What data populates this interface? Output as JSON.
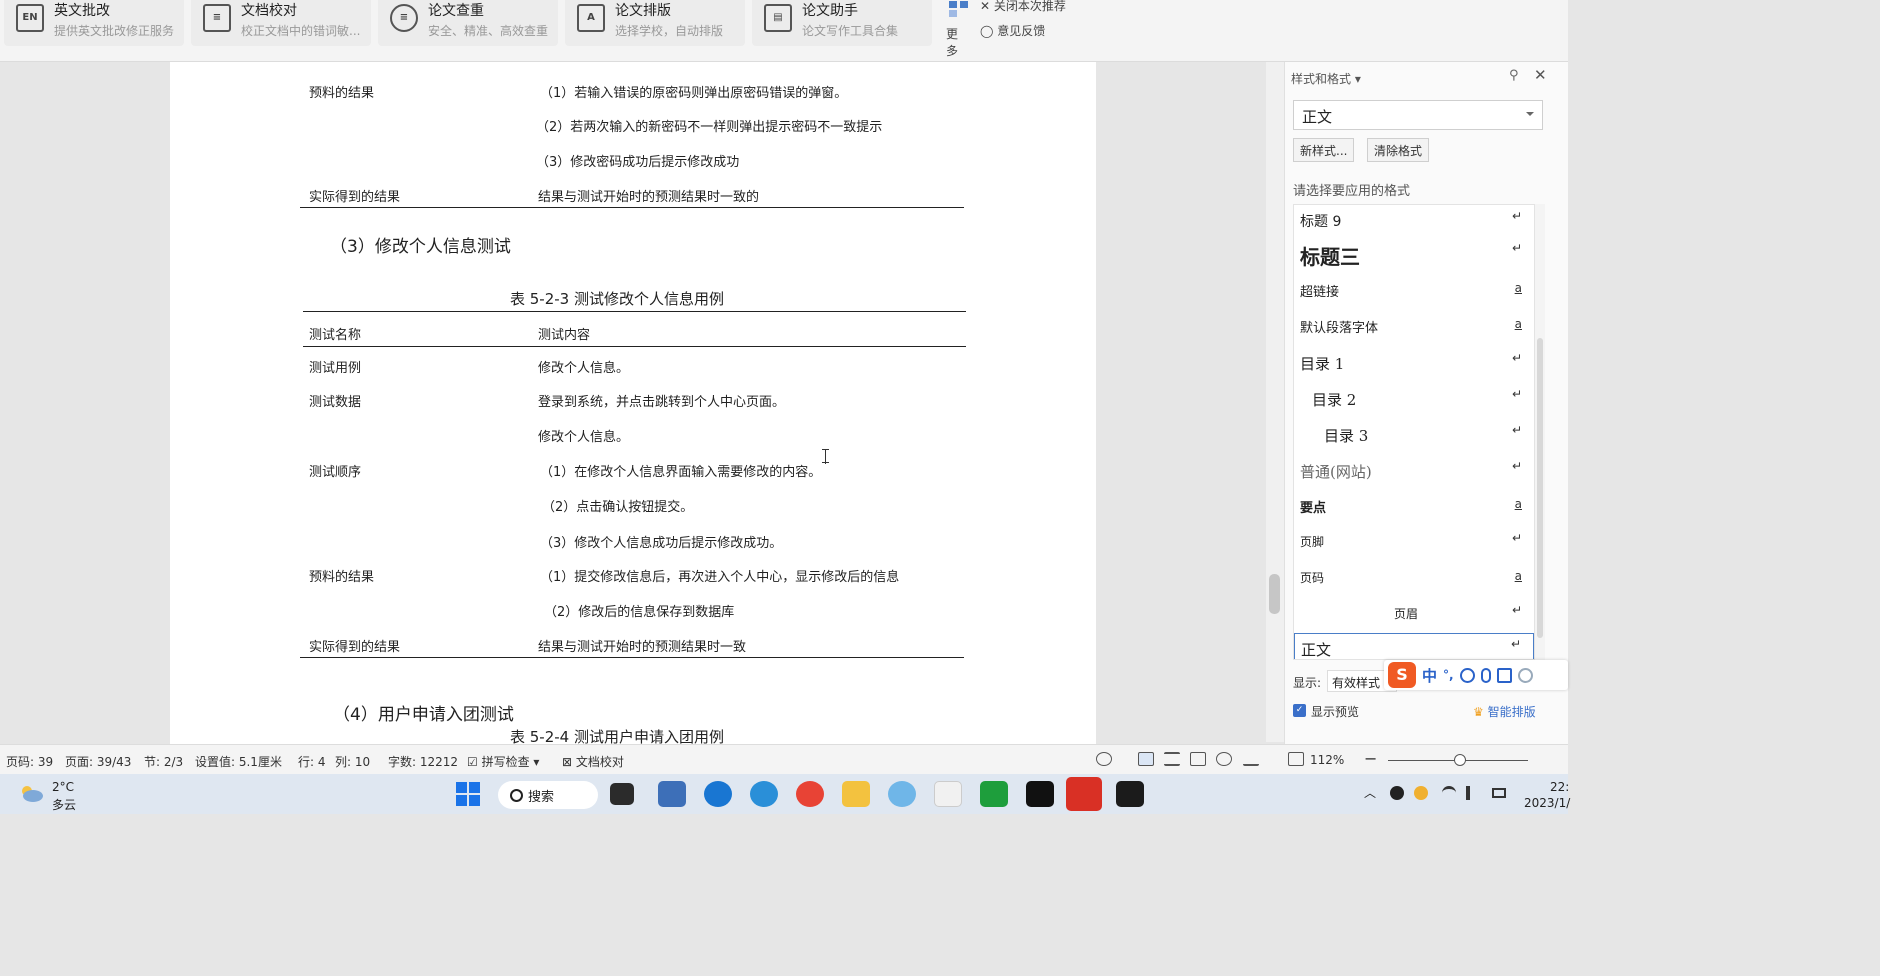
{
  "ribbon": {
    "tools": [
      {
        "title": "英文批改",
        "subtitle": "提供英文批改修正服务",
        "icon": "en-check-icon"
      },
      {
        "title": "文档校对",
        "subtitle": "校正文档中的错词敏...",
        "icon": "doc-proof-icon"
      },
      {
        "title": "论文查重",
        "subtitle": "安全、精准、高效查重",
        "icon": "plagiarism-icon"
      },
      {
        "title": "论文排版",
        "subtitle": "选择学校，自动排版",
        "icon": "paper-layout-icon"
      },
      {
        "title": "论文助手",
        "subtitle": "论文写作工具合集",
        "icon": "paper-assistant-icon"
      }
    ],
    "more": "更多",
    "close_recommend": "关闭本次推荐",
    "feedback": "意见反馈"
  },
  "doc": {
    "prev_rows": [
      {
        "label": "预料的结果",
        "value": "（1）若输入错误的原密码则弹出原密码错误的弹窗。"
      },
      {
        "label": "",
        "value": "（2）若两次输入的新密码不一样则弹出提示密码不一致提示"
      },
      {
        "label": "",
        "value": "（3）修改密码成功后提示修改成功"
      },
      {
        "label": "实际得到的结果",
        "value": "结果与测试开始时的预测结果时一致的"
      }
    ],
    "section3_heading": "（3）修改个人信息测试",
    "table3_caption": "表 5-2-3 测试修改个人信息用例",
    "table3_header": {
      "col1": "测试名称",
      "col2": "测试内容"
    },
    "table3_rows": [
      {
        "label": "测试用例",
        "value": "修改个人信息。"
      },
      {
        "label": "测试数据",
        "value": "登录到系统，并点击跳转到个人中心页面。"
      },
      {
        "label": "",
        "value": "修改个人信息。"
      },
      {
        "label": "测试顺序",
        "value": "（1）在修改个人信息界面输入需要修改的内容。"
      },
      {
        "label": "",
        "value": "（2）点击确认按钮提交。"
      },
      {
        "label": "",
        "value": "（3）修改个人信息成功后提示修改成功。"
      },
      {
        "label": "预料的结果",
        "value": "（1）提交修改信息后，再次进入个人中心，显示修改后的信息"
      },
      {
        "label": "",
        "value": "（2）修改后的信息保存到数据库"
      },
      {
        "label": "实际得到的结果",
        "value": "结果与测试开始时的预测结果时一致"
      }
    ],
    "section4_heading": "（4）用户申请入团测试",
    "table4_caption": "表 5-2-4 测试用户申请入团用例"
  },
  "style_pane": {
    "title": "样式和格式",
    "current_style": "正文",
    "new_style_button": "新样式...",
    "clear_format_button": "清除格式",
    "choose_label": "请选择要应用的格式",
    "styles": [
      {
        "label": "标题  9",
        "mark": "↵"
      },
      {
        "label": "标题三",
        "mark": "↵"
      },
      {
        "label": "超链接",
        "mark": "a"
      },
      {
        "label": "默认段落字体",
        "mark": "a"
      },
      {
        "label": "目录  1",
        "mark": "↵"
      },
      {
        "label": "目录  2",
        "mark": "↵"
      },
      {
        "label": "目录  3",
        "mark": "↵"
      },
      {
        "label": "普通(网站)",
        "mark": "↵"
      },
      {
        "label": "要点",
        "mark": "a"
      },
      {
        "label": "页脚",
        "mark": "↵"
      },
      {
        "label": "页码",
        "mark": "a"
      },
      {
        "label": "页眉",
        "mark": "↵"
      },
      {
        "label": "正文",
        "mark": "↵"
      }
    ],
    "show_label": "显示:",
    "show_value": "有效样式",
    "preview_label": "显示预览",
    "smart_layout": "智能排版"
  },
  "ime": {
    "logo": "S",
    "mode": "中",
    "punct": "°,"
  },
  "status": {
    "page_no": "页码: 39",
    "pages": "页面: 39/43",
    "section": "节: 2/3",
    "setting": "设置值: 5.1厘米",
    "row": "行: 4",
    "col": "列: 10",
    "word_count": "字数: 12212",
    "spell_check": "拼写检查",
    "doc_proof": "文档校对",
    "zoom": "112%"
  },
  "taskbar": {
    "temperature": "2°C",
    "condition": "多云",
    "search": "搜索",
    "time": "22:",
    "date": "2023/1/"
  },
  "colors": {
    "accent": "#3a6fc9",
    "ime_orange": "#f05a23",
    "taskbar": "#dfe7f1"
  }
}
